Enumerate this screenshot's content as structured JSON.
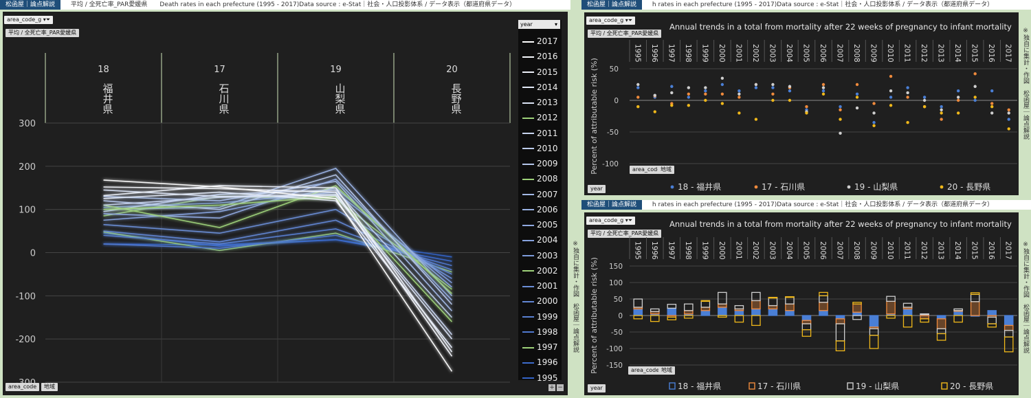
{
  "left": {
    "tag": "松函屋｜論点解説",
    "header": "平均 / 全死亡率_PAR愛媛県　　Death rates in each prefecture (1995 - 2017)Data source : e-Stat｜社会・人口投影体系 / データ表示（都道府県データ）",
    "filter_chip": "area_code_g",
    "measure_chip": "平均 / 全死亡率_PAR愛媛県",
    "bottom_chip_1": "area_code",
    "bottom_chip_2": "地域",
    "legend_title": "year",
    "side_note": "※独自に集計・作図　松函屋｜論点解説",
    "zoom_plus": "+",
    "zoom_minus": "−"
  },
  "top_right": {
    "tag": "松函屋｜論点解説",
    "header": "h rates in each prefecture (1995 - 2017)Data source : e-Stat｜社会・人口投影体系 / データ表示（都道府県データ）",
    "filter_chip": "area_code_g",
    "measure_chip": "平均 / 全死亡率_PAR愛媛県",
    "title": "Annual trends in a total from mortality after 22 weeks of pregnancy to infant mortality",
    "ylabel": "Percent of attributable risk (%)",
    "chip_1": "area_code",
    "chip_2": "地域",
    "year_chip": "year",
    "side_note": "※独自に集計・作図　松函屋｜論点解説"
  },
  "bottom_right": {
    "tag": "松函屋｜論点解説",
    "header": "h rates in each prefecture (1995 - 2017)Data source : e-Stat｜社会・人口投影体系 / データ表示（都道府県データ）",
    "filter_chip": "area_code_g",
    "measure_chip": "平均 / 全死亡率_PAR愛媛県",
    "title": "Annual trends in a total from mortality after 22 weeks of pregnancy to infant mortality",
    "ylabel": "Percent of attributable risk (%)",
    "chip_1": "area_code",
    "chip_2": "地域",
    "year_chip": "year",
    "side_note": "※独自に集計・作図　松函屋｜論点解説"
  },
  "colors": {
    "fukui": "#4a7fd6",
    "ishikawa": "#ef8a3c",
    "yamanashi": "#cfcfcf",
    "nagano": "#f0b81a",
    "bg": "#1f1f1f"
  },
  "chart_data": [
    {
      "type": "line",
      "categories": [
        "18|福井県",
        "17|石川県",
        "19|山梨県",
        "20|長野県"
      ],
      "ylim": [
        -300,
        300
      ],
      "yticks": [
        300,
        200,
        100,
        0,
        -100,
        -200,
        -300
      ],
      "legend_position": "right",
      "series": [
        {
          "name": "2017",
          "values": [
            168,
            152,
            125,
            -275
          ]
        },
        {
          "name": "2016",
          "values": [
            152,
            148,
            140,
            -240
          ]
        },
        {
          "name": "2015",
          "values": [
            132,
            155,
            150,
            -230
          ]
        },
        {
          "name": "2014",
          "values": [
            125,
            140,
            120,
            -220
          ]
        },
        {
          "name": "2013",
          "values": [
            145,
            130,
            132,
            -200
          ]
        },
        {
          "name": "2012",
          "values": [
            100,
            110,
            130,
            -160
          ]
        },
        {
          "name": "2011",
          "values": [
            110,
            128,
            135,
            -190
          ]
        },
        {
          "name": "2010",
          "values": [
            95,
            135,
            145,
            -150
          ]
        },
        {
          "name": "2009",
          "values": [
            120,
            100,
            180,
            -120
          ]
        },
        {
          "name": "2008",
          "values": [
            110,
            58,
            155,
            -95
          ]
        },
        {
          "name": "2007",
          "values": [
            130,
            120,
            165,
            -135
          ]
        },
        {
          "name": "2006",
          "values": [
            100,
            105,
            195,
            -100
          ]
        },
        {
          "name": "2005",
          "values": [
            90,
            80,
            170,
            -110
          ]
        },
        {
          "name": "2004",
          "values": [
            75,
            95,
            150,
            -80
          ]
        },
        {
          "name": "2003",
          "values": [
            105,
            115,
            140,
            -70
          ]
        },
        {
          "name": "2002",
          "values": [
            85,
            130,
            125,
            -85
          ]
        },
        {
          "name": "2001",
          "values": [
            65,
            45,
            100,
            -60
          ]
        },
        {
          "name": "2000",
          "values": [
            50,
            25,
            75,
            -50
          ]
        },
        {
          "name": "1999",
          "values": [
            40,
            20,
            55,
            -40
          ]
        },
        {
          "name": "1998",
          "values": [
            20,
            10,
            40,
            -30
          ]
        },
        {
          "name": "1997",
          "values": [
            48,
            5,
            45,
            -45
          ]
        },
        {
          "name": "1996",
          "values": [
            45,
            15,
            30,
            -20
          ]
        },
        {
          "name": "1995",
          "values": [
            20,
            18,
            30,
            -10
          ]
        }
      ]
    },
    {
      "type": "scatter",
      "title": "Annual trends in a total from mortality after 22 weeks of pregnancy to infant mortality",
      "ylabel": "Percent of attributable risk (%)",
      "ylim": [
        -100,
        50
      ],
      "yticks": [
        50,
        0,
        -50,
        -100
      ],
      "legend_position": "bottom",
      "categories": [
        "1995",
        "1996",
        "1997",
        "1998",
        "1999",
        "2000",
        "2001",
        "2002",
        "2003",
        "2004",
        "2005",
        "2006",
        "2007",
        "2008",
        "2009",
        "2010",
        "2011",
        "2012",
        "2013",
        "2014",
        "2015",
        "2016",
        "2017"
      ],
      "series": [
        {
          "name": "18 - 福井県",
          "values": [
            20,
            5,
            22,
            5,
            15,
            25,
            15,
            20,
            20,
            15,
            -15,
            15,
            -10,
            10,
            -35,
            5,
            20,
            5,
            -10,
            15,
            0,
            15,
            -30
          ]
        },
        {
          "name": "17 - 石川県",
          "values": [
            5,
            7,
            -5,
            10,
            10,
            10,
            5,
            25,
            10,
            20,
            -10,
            25,
            -15,
            25,
            -5,
            38,
            5,
            -10,
            -30,
            0,
            42,
            -5,
            -15
          ]
        },
        {
          "name": "19 - 山梨県",
          "values": [
            25,
            8,
            12,
            20,
            20,
            35,
            10,
            25,
            25,
            22,
            -18,
            20,
            -52,
            -12,
            -20,
            15,
            12,
            0,
            -15,
            5,
            22,
            -20,
            -20
          ]
        },
        {
          "name": "20 - 長野県",
          "values": [
            -10,
            -18,
            -8,
            -8,
            0,
            -5,
            -20,
            -30,
            0,
            0,
            -20,
            10,
            -30,
            5,
            -40,
            -8,
            -35,
            -10,
            -20,
            -20,
            5,
            -10,
            -45
          ]
        }
      ]
    },
    {
      "type": "bar",
      "title": "Annual trends in a total from mortality after 22 weeks of pregnancy to infant mortality",
      "ylabel": "Percent of attributable risk (%)",
      "ylim": [
        -150,
        150
      ],
      "yticks": [
        150,
        100,
        50,
        0,
        -50,
        -100,
        -150
      ],
      "legend_position": "bottom",
      "categories": [
        "1995",
        "1996",
        "1997",
        "1998",
        "1999",
        "2000",
        "2001",
        "2002",
        "2003",
        "2004",
        "2005",
        "2006",
        "2007",
        "2008",
        "2009",
        "2010",
        "2011",
        "2012",
        "2013",
        "2014",
        "2015",
        "2016",
        "2017"
      ],
      "series": [
        {
          "name": "18 - 福井県",
          "values": [
            20,
            5,
            22,
            5,
            15,
            25,
            15,
            20,
            20,
            15,
            -15,
            15,
            -10,
            10,
            -35,
            5,
            20,
            5,
            -10,
            15,
            0,
            15,
            -30
          ]
        },
        {
          "name": "17 - 石川県",
          "values": [
            5,
            7,
            -5,
            10,
            10,
            10,
            5,
            25,
            10,
            20,
            -10,
            25,
            -15,
            25,
            -5,
            38,
            5,
            -10,
            -30,
            0,
            42,
            -5,
            -15
          ]
        },
        {
          "name": "19 - 山梨県",
          "values": [
            25,
            8,
            12,
            20,
            20,
            35,
            10,
            25,
            25,
            22,
            -18,
            20,
            -52,
            -12,
            -20,
            15,
            12,
            0,
            -15,
            5,
            22,
            -20,
            -20
          ]
        },
        {
          "name": "20 - 長野県",
          "values": [
            -10,
            -18,
            -8,
            -8,
            0,
            -5,
            -20,
            -30,
            0,
            0,
            -20,
            10,
            -30,
            5,
            -40,
            -8,
            -35,
            -10,
            -20,
            -20,
            5,
            -10,
            -45
          ]
        }
      ]
    }
  ]
}
